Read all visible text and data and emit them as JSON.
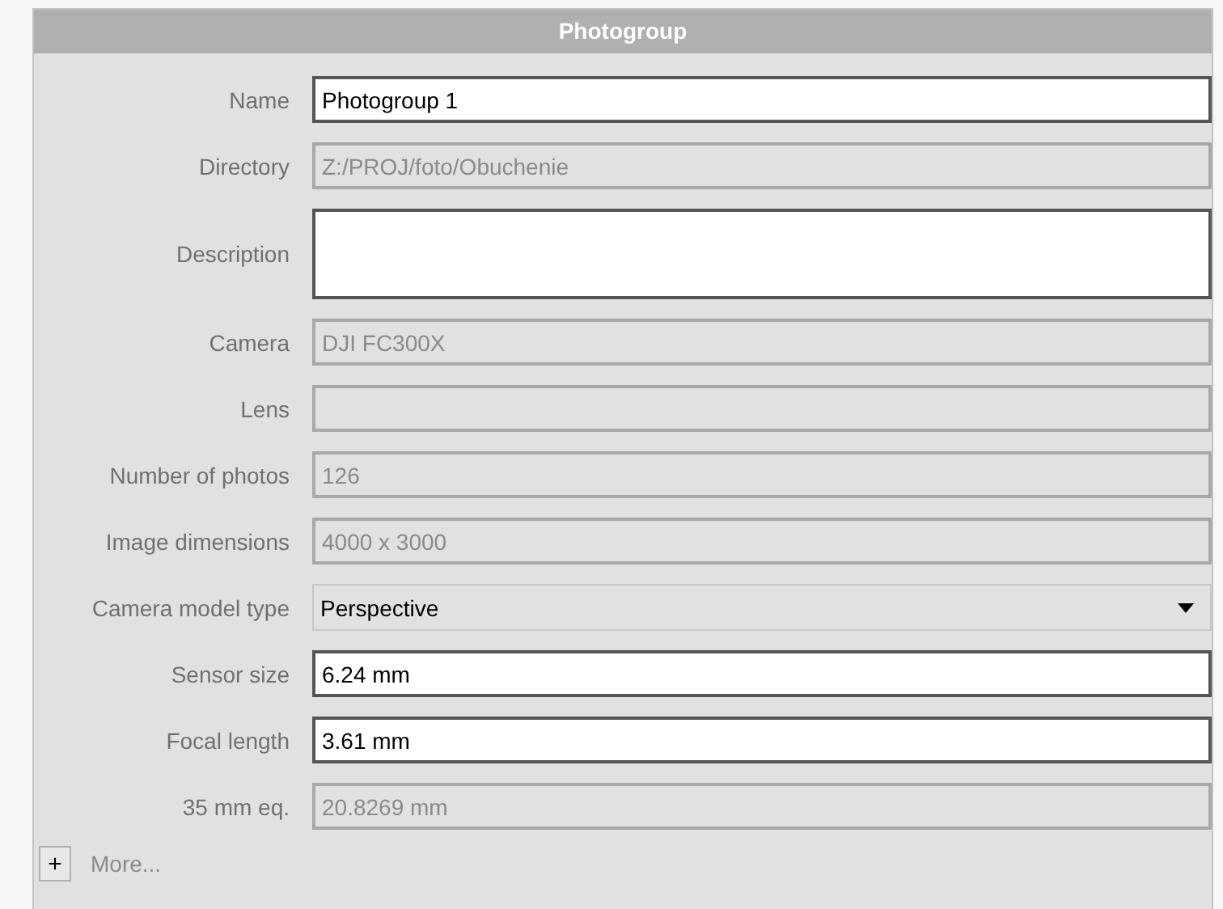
{
  "panel": {
    "title": "Photogroup"
  },
  "fields": [
    {
      "label": "Name",
      "kind": "text",
      "disabled": false,
      "value": "Photogroup 1"
    },
    {
      "label": "Directory",
      "kind": "text",
      "disabled": true,
      "value": "Z:/PROJ/foto/Obuchenie"
    },
    {
      "label": "Description",
      "kind": "textarea",
      "disabled": false
    },
    {
      "label": "Camera",
      "kind": "text",
      "disabled": true,
      "value": "DJI FC300X"
    },
    {
      "label": "Lens",
      "kind": "text",
      "disabled": true
    },
    {
      "label": "Number of photos",
      "kind": "text",
      "disabled": true,
      "value": "126"
    },
    {
      "label": "Image dimensions",
      "kind": "text",
      "disabled": true,
      "value": "4000 x 3000"
    },
    {
      "label": "Camera model type",
      "kind": "select",
      "disabled": false,
      "value": "Perspective"
    },
    {
      "label": "Sensor size",
      "kind": "text",
      "disabled": false,
      "value": "6.24 mm"
    },
    {
      "label": "Focal length",
      "kind": "text",
      "disabled": false,
      "value": "3.61 mm"
    },
    {
      "label": "35 mm eq.",
      "kind": "text",
      "disabled": true,
      "value": "20.8269 mm"
    }
  ],
  "more": {
    "button": "+",
    "label": "More..."
  }
}
